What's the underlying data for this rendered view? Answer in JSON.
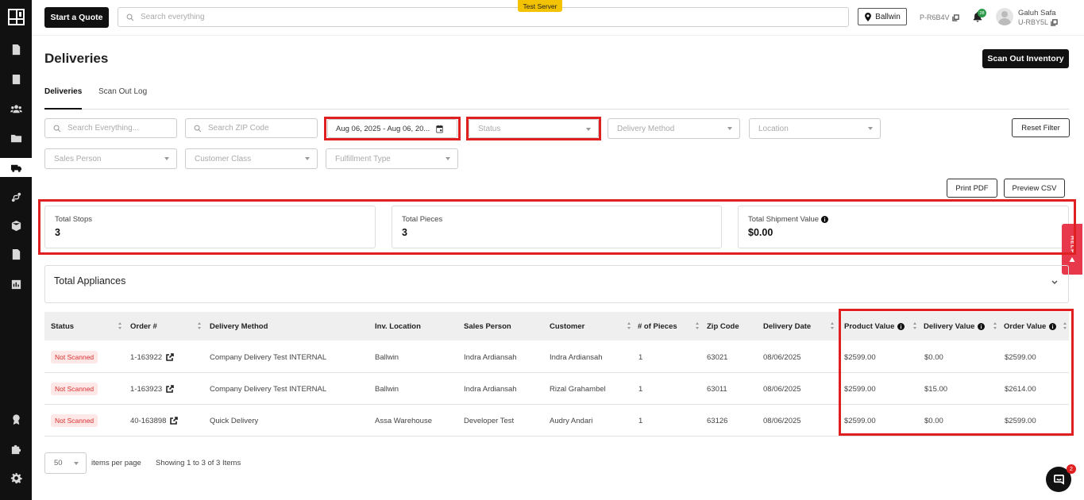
{
  "topbar": {
    "quote_button": "Start a Quote",
    "search_placeholder": "Search everything",
    "server_badge": "Test Server",
    "location": "Ballwin",
    "printer_code": "P-R6B4V",
    "notification_count": "28",
    "user_name": "Galuh Safa",
    "user_code": "U-RBY5L"
  },
  "page": {
    "title": "Deliveries",
    "scan_out_button": "Scan Out Inventory"
  },
  "tabs": [
    "Deliveries",
    "Scan Out Log"
  ],
  "filters": {
    "search_placeholder": "Search Everything...",
    "zip_placeholder": "Search ZIP Code",
    "date_range": "Aug 06, 2025 - Aug 06, 20...",
    "status": "Status",
    "delivery_method": "Delivery Method",
    "location": "Location",
    "reset": "Reset Filter",
    "sales_person": "Sales Person",
    "customer_class": "Customer Class",
    "fulfillment_type": "Fulfillment Type"
  },
  "actions": {
    "print_pdf": "Print PDF",
    "preview_csv": "Preview CSV"
  },
  "stats": [
    {
      "label": "Total Stops",
      "value": "3"
    },
    {
      "label": "Total Pieces",
      "value": "3"
    },
    {
      "label": "Total Shipment Value",
      "value": "$0.00"
    }
  ],
  "help_tab": "HELP",
  "accordion": {
    "title": "Total Appliances"
  },
  "table": {
    "headers": [
      "Status",
      "Order #",
      "Delivery Method",
      "Inv. Location",
      "Sales Person",
      "Customer",
      "# of Pieces",
      "Zip Code",
      "Delivery Date",
      "Product Value",
      "Delivery Value",
      "Order Value"
    ],
    "rows": [
      {
        "status": "Not Scanned",
        "order": "1-163922",
        "method": "Company Delivery Test INTERNAL",
        "location": "Ballwin",
        "sales": "Indra Ardiansah",
        "customer": "Indra Ardiansah",
        "pieces": "1",
        "zip": "63021",
        "date": "08/06/2025",
        "product_value": "$2599.00",
        "delivery_value": "$0.00",
        "order_value": "$2599.00"
      },
      {
        "status": "Not Scanned",
        "order": "1-163923",
        "method": "Company Delivery Test INTERNAL",
        "location": "Ballwin",
        "sales": "Indra Ardiansah",
        "customer": "Rizal Grahambel",
        "pieces": "1",
        "zip": "63011",
        "date": "08/06/2025",
        "product_value": "$2599.00",
        "delivery_value": "$15.00",
        "order_value": "$2614.00"
      },
      {
        "status": "Not Scanned",
        "order": "40-163898",
        "method": "Quick Delivery",
        "location": "Assa Warehouse",
        "sales": "Developer Test",
        "customer": "Audry Andari",
        "pieces": "1",
        "zip": "63126",
        "date": "08/06/2025",
        "product_value": "$2599.00",
        "delivery_value": "$0.00",
        "order_value": "$2599.00"
      }
    ]
  },
  "pagination": {
    "per_page": "50",
    "per_page_label": "items per page",
    "showing": "Showing 1 to 3 of 3 Items"
  },
  "chat_badge": "2"
}
